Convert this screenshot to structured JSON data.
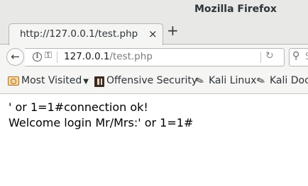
{
  "window": {
    "title": "Mozilla Firefox"
  },
  "tab": {
    "label": "http://127.0.0.1/test.php",
    "close_glyph": "×",
    "new_tab_glyph": "+"
  },
  "navbar": {
    "back_glyph": "←",
    "url_host": "127.0.0.1",
    "url_path": "/test.php",
    "reload_glyph": "↻",
    "search_placeholder": "S"
  },
  "bookmarks": [
    {
      "label": "Most Visited",
      "icon": "most-visited-folder-icon"
    },
    {
      "label": "Offensive Security",
      "icon": "offensive-security-icon"
    },
    {
      "label": "Kali Linux",
      "icon": "kali-dragon-icon"
    },
    {
      "label": "Kali Docs",
      "icon": "kali-dragon-icon"
    }
  ],
  "page": {
    "lines": [
      "' or 1=1#connection ok!",
      "Welcome login Mr/Mrs:' or 1=1#"
    ]
  },
  "colors": {
    "chrome": "#e8e8e7",
    "toolbar": "#f5f5f4",
    "border": "#b6b6b3"
  }
}
